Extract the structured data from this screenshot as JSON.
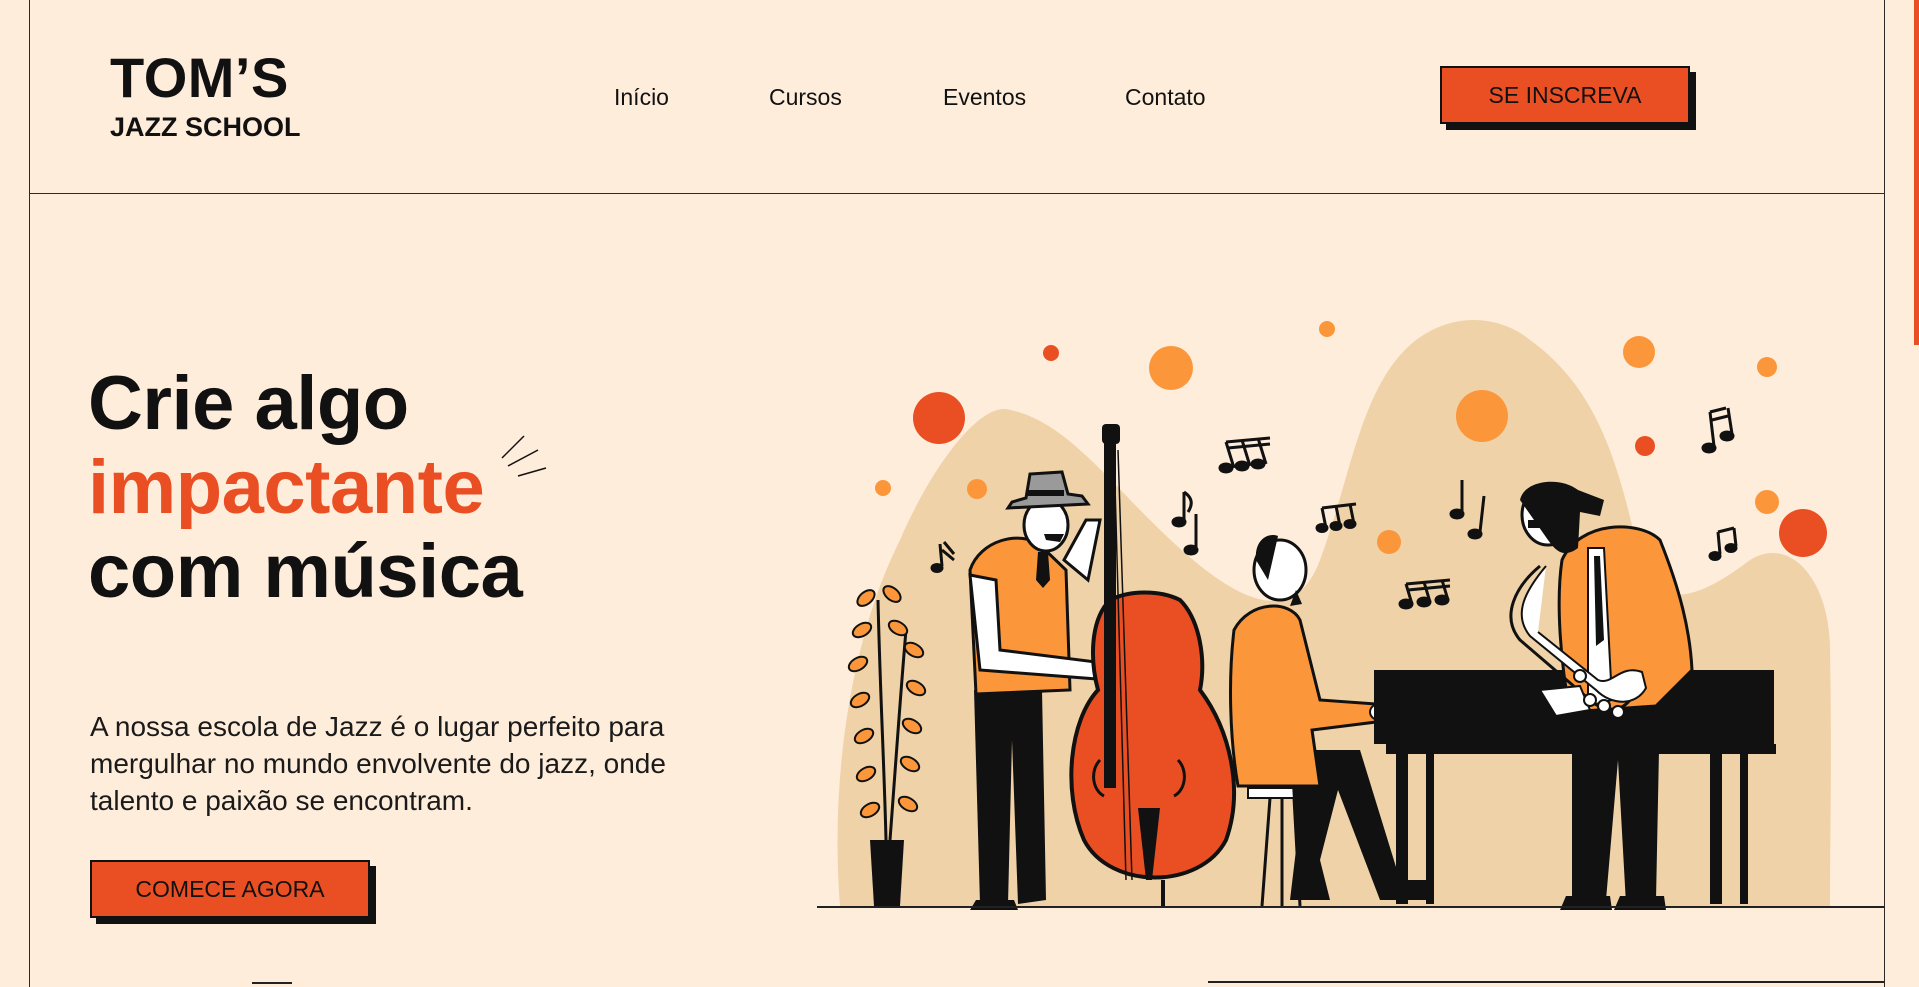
{
  "brand": {
    "name": "TOM’S",
    "tagline": "JAZZ SCHOOL"
  },
  "nav": {
    "items": [
      "Início",
      "Cursos",
      "Eventos",
      "Contato"
    ]
  },
  "header": {
    "cta_label": "SE INSCREVA"
  },
  "hero": {
    "title_line1": "Crie algo",
    "title_accent": "impactante",
    "title_line3": "com música",
    "description": "A nossa escola de Jazz é o lugar perfeito para mergulhar no mundo envolvente do jazz, onde talento e paixão se encontram.",
    "cta_label": "COMECE AGORA"
  },
  "illustration": {
    "icons": [
      "jazz-band-illustration",
      "double-bass-player",
      "pianist",
      "saxophone-player",
      "potted-plant",
      "music-notes"
    ]
  },
  "colors": {
    "background": "#ffeddb",
    "accent": "#ea4f24",
    "accent_light": "#fb963a",
    "blob": "#efd2a8",
    "ink": "#111111"
  }
}
